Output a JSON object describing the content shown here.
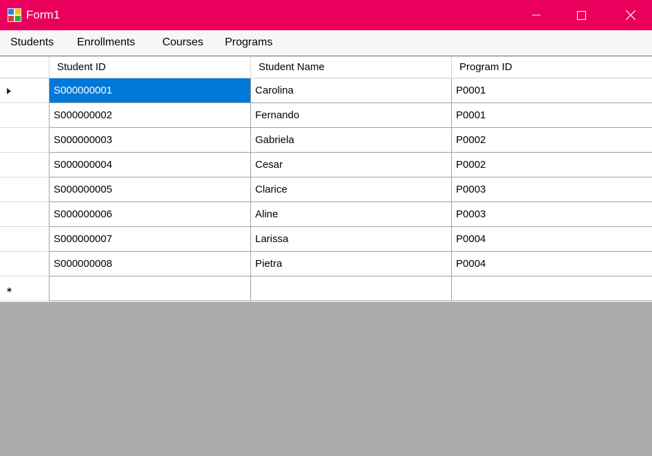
{
  "window": {
    "title": "Form1",
    "colors": {
      "titlebar": "#e8005c",
      "selection": "#0078d7",
      "empty_area": "#ababab"
    }
  },
  "menu": {
    "items": [
      "Students",
      "Enrollments",
      "Courses",
      "Programs"
    ]
  },
  "grid": {
    "columns": [
      "Student ID",
      "Student Name",
      "Program ID"
    ],
    "sorted_column": "Student ID",
    "sort_direction": "ascending",
    "selected_row": 0,
    "rows": [
      [
        "S000000001",
        "Carolina",
        "P0001"
      ],
      [
        "S000000002",
        "Fernando",
        "P0001"
      ],
      [
        "S000000003",
        "Gabriela",
        "P0002"
      ],
      [
        "S000000004",
        "Cesar",
        "P0002"
      ],
      [
        "S000000005",
        "Clarice",
        "P0003"
      ],
      [
        "S000000006",
        "Aline",
        "P0003"
      ],
      [
        "S000000007",
        "Larissa",
        "P0004"
      ],
      [
        "S000000008",
        "Pietra",
        "P0004"
      ]
    ],
    "new_row_marker": "*"
  }
}
